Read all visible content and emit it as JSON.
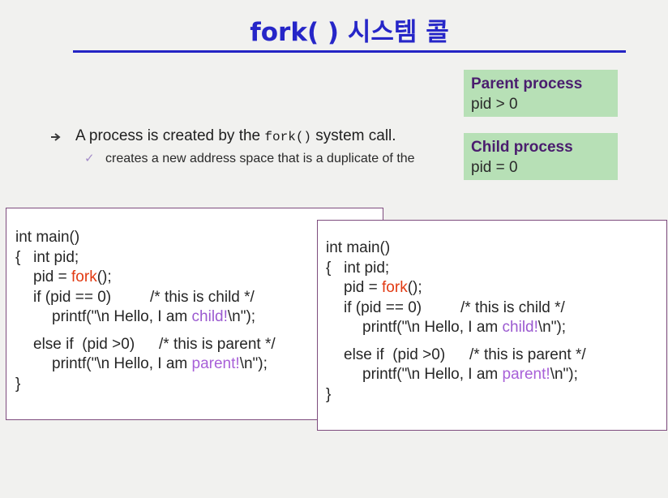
{
  "title": "fork( ) 시스템 콜",
  "colors": {
    "title": "#2626c8",
    "box_bg": "#b7e0b6",
    "box_head": "#4a1d6e",
    "fork": "#e23a12",
    "highlight": "#9b5ad0"
  },
  "parent_box": {
    "heading": "Parent process",
    "condition": "pid > 0"
  },
  "child_box": {
    "heading": "Child process",
    "condition": "pid = 0"
  },
  "bullet": {
    "icon": "arrow-bullet-icon",
    "text_before": "A process is created by the ",
    "code": "fork()",
    "text_after": " system call."
  },
  "sub_bullet": {
    "icon": "checkmark-icon",
    "text": "creates a new address space that is a duplicate of the"
  },
  "code": {
    "l1": "int main()",
    "l2": "{   int pid;",
    "l3_pre": "pid = ",
    "fork_kw": "fork",
    "l3_post": "();",
    "l4_cond": "if (pid == 0)",
    "l4_cmt": "/* this is child */",
    "printf_pre": "printf(\"\\n Hello, I am ",
    "child_word": "child!",
    "parent_word": "parent!",
    "printf_post": "\\n\");",
    "l6_cond": "else if  (pid >0)",
    "l6_cmt": "/* this is parent */",
    "l8": "}"
  }
}
